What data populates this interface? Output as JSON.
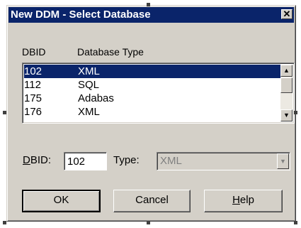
{
  "window": {
    "title": "New DDM - Select Database",
    "close_glyph": "✕"
  },
  "list": {
    "headers": {
      "dbid": "DBID",
      "type": "Database Type"
    },
    "rows": [
      {
        "dbid": "102",
        "type": "XML",
        "selected": true
      },
      {
        "dbid": "112",
        "type": "SQL",
        "selected": false
      },
      {
        "dbid": "175",
        "type": "Adabas",
        "selected": false
      },
      {
        "dbid": "176",
        "type": "XML",
        "selected": false
      }
    ],
    "scroll": {
      "up_glyph": "▲",
      "down_glyph": "▼"
    }
  },
  "form": {
    "dbid_label_mnemonic": "D",
    "dbid_label_rest": "BID:",
    "dbid_value": "102",
    "type_label": "Type:",
    "type_value": "XML",
    "dropdown_glyph": "▼"
  },
  "buttons": {
    "ok": "OK",
    "cancel": "Cancel",
    "help_mnemonic": "H",
    "help_rest": "elp"
  },
  "colors": {
    "title_bar": "#0a246a",
    "dialog_face": "#d4d0c8",
    "selection": "#0a246a"
  }
}
